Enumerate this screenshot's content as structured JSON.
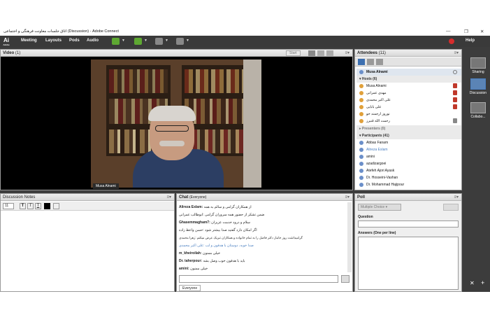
{
  "window": {
    "title": "اتاق جلسات معاونت فرهنگی و اجتماعی (Discussion) - Adobe Connect",
    "logo_text": "Ai",
    "logo_sub": "Adobe"
  },
  "menu": {
    "items": [
      "Meeting",
      "Layouts",
      "Pods",
      "Audio"
    ],
    "help": "Help"
  },
  "video": {
    "title": "Video",
    "count": "(1)",
    "start_label": "Start",
    "presenter_name": "Musa Alnami"
  },
  "attendees": {
    "title": "Attendees",
    "count": "(11)",
    "current_user": "Musa Alnami",
    "hosts_label": "Hosts (6)",
    "hosts": [
      "Musa Alnami",
      "مهدی عمرانی",
      "علی اکبر محمدی",
      "علی بابایی",
      "نوروز ارجمند خو",
      "رحمت الله قنبرز"
    ],
    "presenters_label": "Presenters (0)",
    "participants_label": "Participants (41)",
    "participants": [
      "Abbas Fanam",
      "Alireza Eslam",
      "amini",
      "azadizargoei",
      "Atefeh Ajori Ayask",
      "Dr. Hosseini-Vashan",
      "Dr. Mohammad Hajipour"
    ]
  },
  "notes": {
    "title": "Discussion Notes",
    "font_size": "11"
  },
  "chat": {
    "title": "Chat",
    "audience": "(Everyone)",
    "messages": [
      {
        "sender": "Alireza Eslam:",
        "text": "از همکاران گرامی و سالم به همه"
      },
      {
        "sender": "",
        "text": "ضمن تشکر از حضور همه سروران گرامی  :ابوطالب عمرانی"
      },
      {
        "sender": "Ghasemmagham7:",
        "text": "سلام و درود خدمت عزیزان"
      },
      {
        "sender": "",
        "text": "اگر امکان دارد گفتید صدا بیشتر شود  :حسن واعظ زاده"
      },
      {
        "sender": "",
        "text": "گرامیداشت روز جانباز دکتر فاضل را به تمام خانواده و همکاران تبریک عرض میکنم  :زهرا محمدی"
      },
      {
        "sender": "",
        "text": "صدا خوبه، دوستان با هدفون و لب  :علی اکبر محمدی"
      },
      {
        "sender": "m_kheiroilah:",
        "text": "خیلی ممنون"
      },
      {
        "sender": "Dr. taherpour:",
        "text": "باید با هدفون خوب وصل بشه"
      },
      {
        "sender": "amini:",
        "text": "خیلی ممنون"
      }
    ],
    "tab_label": "Everyone"
  },
  "poll": {
    "title": "Poll",
    "select_value": "Multiple Choice",
    "question_label": "Question",
    "answers_label": "Answers (One per line)"
  },
  "sidebar": {
    "items": [
      "Sharing",
      "Discussion",
      "Collabo..."
    ]
  },
  "colors": {
    "menubar": "#3a3a3a",
    "desk": "#3c3c3c",
    "accent": "#4a7fc1"
  }
}
